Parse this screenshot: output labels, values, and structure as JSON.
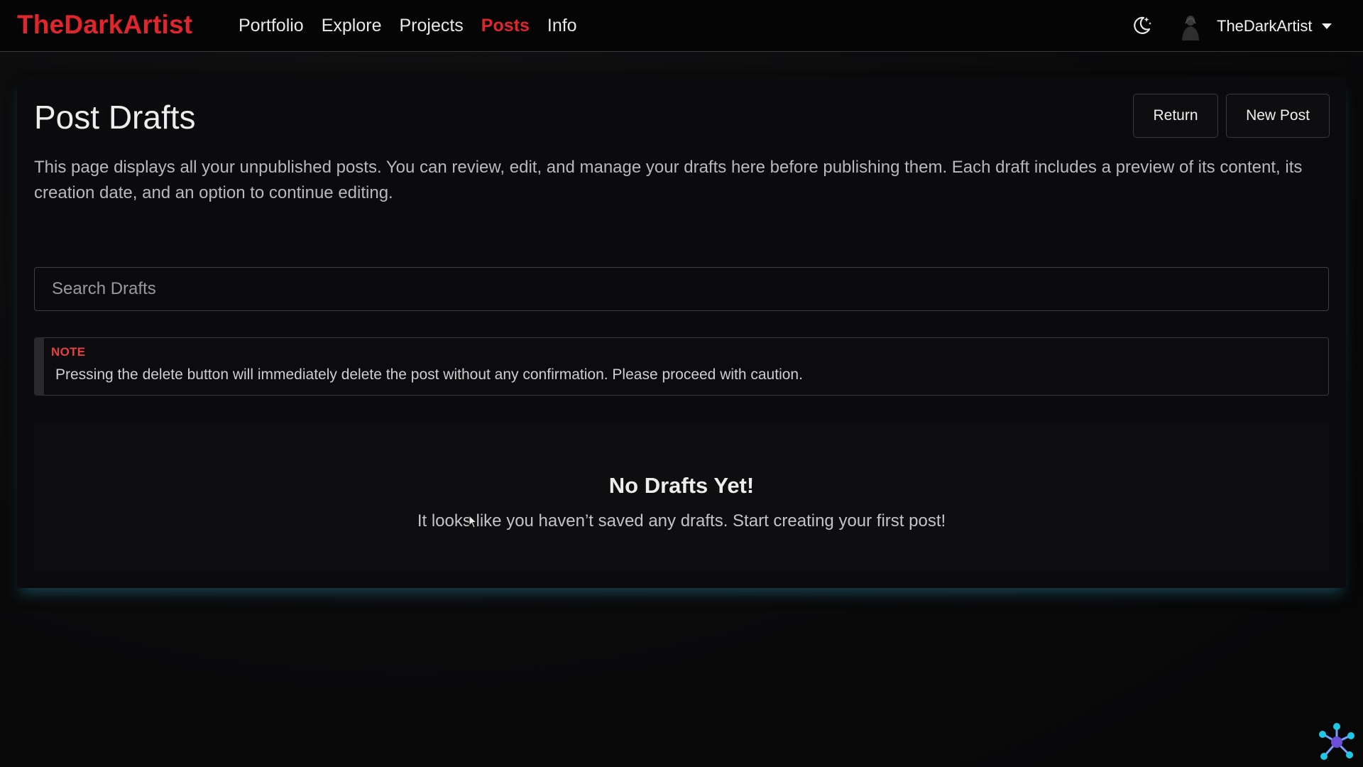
{
  "brand": {
    "name": "TheDarkArtist",
    "color": "#e0262c"
  },
  "nav": {
    "links": [
      {
        "label": "Portfolio",
        "active": false
      },
      {
        "label": "Explore",
        "active": false
      },
      {
        "label": "Projects",
        "active": false
      },
      {
        "label": "Posts",
        "active": true
      },
      {
        "label": "Info",
        "active": false
      }
    ],
    "theme_icon": "moon-stars-icon",
    "user": {
      "name": "TheDarkArtist",
      "avatar_icon": "avatar-icon",
      "caret_icon": "caret-down-icon"
    }
  },
  "page": {
    "title": "Post Drafts",
    "return_label": "Return",
    "new_post_label": "New Post",
    "description": "This page displays all your unpublished posts. You can review, edit, and manage your drafts here before publishing them. Each draft includes a preview of its content, its creation date, and an option to continue editing.",
    "search": {
      "placeholder": "Search Drafts",
      "value": ""
    },
    "note": {
      "label": "NOTE",
      "text": "Pressing the delete button will immediately delete the post without any confirmation. Please proceed with caution."
    },
    "empty_state": {
      "title": "No Drafts Yet!",
      "text": "It looks like you haven’t saved any drafts. Start creating your first post!"
    }
  },
  "colors": {
    "accent": "#e0262c",
    "card_glow": "#2878a0",
    "background": "#0a0a0b"
  }
}
